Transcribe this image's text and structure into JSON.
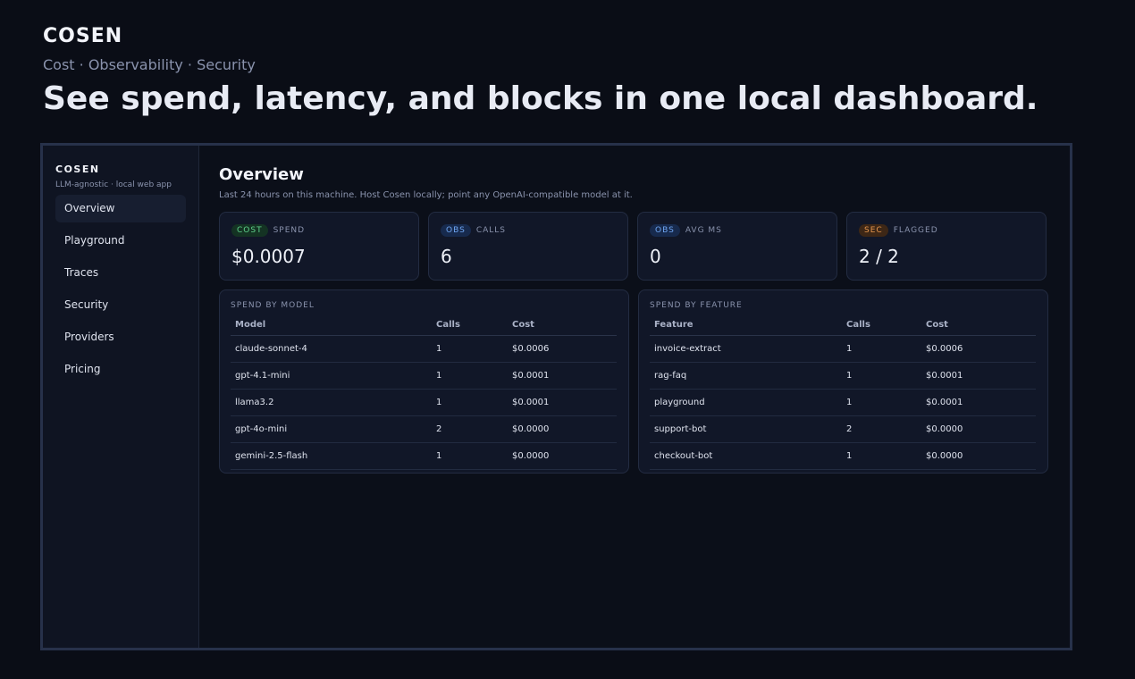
{
  "hero": {
    "brand": "COSEN",
    "tagline": "Cost · Observability · Security",
    "headline": "See spend, latency, and blocks in one local dashboard."
  },
  "sidebar": {
    "brand": "COSEN",
    "subtitle": "LLM-agnostic · local web app",
    "items": [
      {
        "label": "Overview"
      },
      {
        "label": "Playground"
      },
      {
        "label": "Traces"
      },
      {
        "label": "Security"
      },
      {
        "label": "Providers"
      },
      {
        "label": "Pricing"
      }
    ]
  },
  "main": {
    "title": "Overview",
    "subtitle": "Last 24 hours on this machine. Host Cosen locally; point any OpenAI-compatible model at it.",
    "cards": [
      {
        "tag": "COST",
        "label": "SPEND",
        "value": "$0.0007"
      },
      {
        "tag": "OBS",
        "label": "CALLS",
        "value": "6"
      },
      {
        "tag": "OBS",
        "label": "AVG MS",
        "value": "0"
      },
      {
        "tag": "SEC",
        "label": "FLAGGED",
        "value": "2 / 2"
      }
    ],
    "spend_by_model": {
      "title": "SPEND BY MODEL",
      "headers": [
        "Model",
        "Calls",
        "Cost"
      ],
      "rows": [
        [
          "claude-sonnet-4",
          "1",
          "$0.0006"
        ],
        [
          "gpt-4.1-mini",
          "1",
          "$0.0001"
        ],
        [
          "llama3.2",
          "1",
          "$0.0001"
        ],
        [
          "gpt-4o-mini",
          "2",
          "$0.0000"
        ],
        [
          "gemini-2.5-flash",
          "1",
          "$0.0000"
        ]
      ]
    },
    "spend_by_feature": {
      "title": "SPEND BY FEATURE",
      "headers": [
        "Feature",
        "Calls",
        "Cost"
      ],
      "rows": [
        [
          "invoice-extract",
          "1",
          "$0.0006"
        ],
        [
          "rag-faq",
          "1",
          "$0.0001"
        ],
        [
          "playground",
          "1",
          "$0.0001"
        ],
        [
          "support-bot",
          "2",
          "$0.0000"
        ],
        [
          "checkout-bot",
          "1",
          "$0.0000"
        ]
      ]
    }
  },
  "colors": {
    "background": "#0a0d16",
    "cost_accent": "#5fd08b",
    "obs_accent": "#6fa6f2",
    "sec_accent": "#e6964e"
  }
}
